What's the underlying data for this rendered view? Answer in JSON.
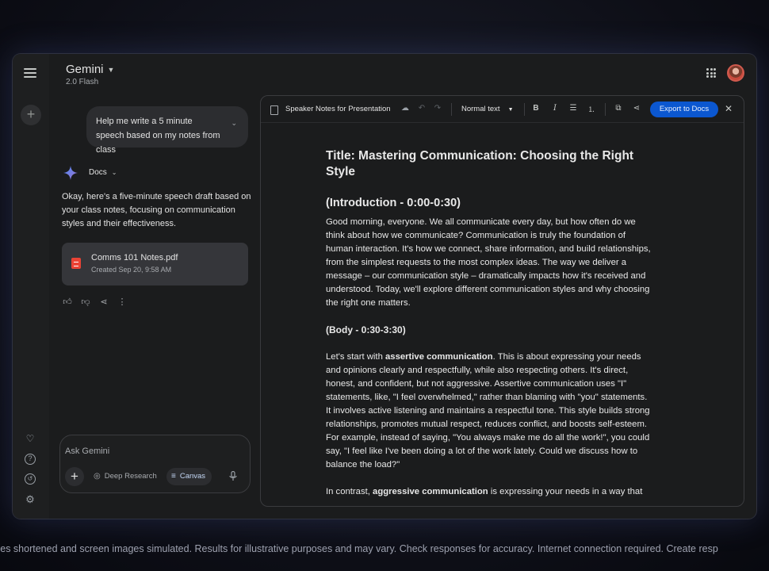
{
  "app": {
    "title": "Gemini",
    "model": "2.0 Flash"
  },
  "chat": {
    "user_message": "Help me write a 5 minute speech based on my notes from class",
    "source_chip": "Docs",
    "response": "Okay, here's a five-minute speech draft based on your class notes, focusing on communication styles and their effectiveness.",
    "file": {
      "name": "Comms 101 Notes.pdf",
      "meta": "Created Sep 20, 9:58 AM"
    },
    "actions": [
      "thumb-up-icon",
      "thumb-down-icon",
      "share-icon",
      "more-vert-icon"
    ]
  },
  "prompt": {
    "placeholder": "Ask Gemini",
    "deep_research": "Deep Research",
    "canvas": "Canvas"
  },
  "canvas": {
    "doc_title": "Speaker Notes for Presentation",
    "text_style": "Normal text",
    "export_label": "Export to Docs",
    "doc": {
      "title": "Title: Mastering Communication: Choosing the Right Style",
      "intro_heading": "(Introduction - 0:00-0:30)",
      "intro_text": "Good morning, everyone. We all communicate every day, but how often do we think about how we communicate? Communication is truly the foundation of human interaction. It's how we connect, share information, and build relationships, from the simplest requests to the most complex ideas. The way we deliver a message – our communication style – dramatically impacts how it's received and understood. Today, we'll explore different communication styles and why choosing the right one matters.",
      "body_heading": "(Body - 0:30-3:30)",
      "body_p1_pre": "Let's start with ",
      "body_p1_bold": "assertive communication",
      "body_p1_post": ". This is about expressing your needs and opinions clearly and respectfully, while also respecting others. It's direct, honest, and confident, but not aggressive. Assertive communication uses \"I\" statements, like, \"I feel overwhelmed,\" rather than blaming with \"you\" statements. It involves active listening and maintains a respectful tone. This style builds strong relationships, promotes mutual respect, reduces conflict, and boosts self-esteem. For example, instead of saying, \"You always make me do all the work!\", you could say, \"I feel like I've been doing a lot of the work lately. Could we discuss how to balance the load?\"",
      "body_p2_pre": "In contrast, ",
      "body_p2_bold": "aggressive communication",
      "body_p2_post": " is expressing your needs in a way that"
    }
  },
  "footer": "ces shortened and screen images simulated. Results for illustrative purposes and may vary. Check responses for accuracy. Internet connection required. Create resp",
  "colors": {
    "accent": "#0b57d0",
    "surface": "#1b1c1d",
    "bubble": "#2c2d30"
  }
}
